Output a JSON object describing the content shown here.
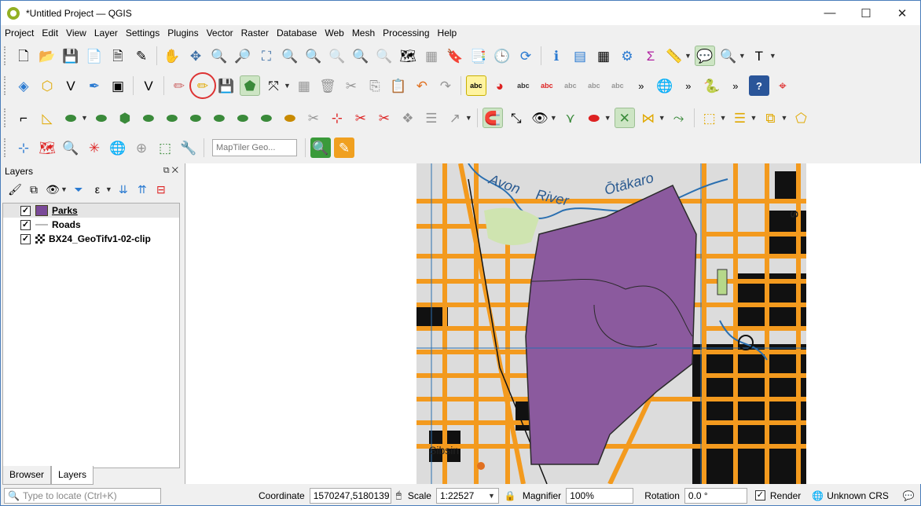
{
  "window": {
    "title": "*Untitled Project — QGIS",
    "minimize": "—",
    "maximize": "☐",
    "close": "✕"
  },
  "menu": [
    "Project",
    "Edit",
    "View",
    "Layer",
    "Settings",
    "Plugins",
    "Vector",
    "Raster",
    "Database",
    "Web",
    "Mesh",
    "Processing",
    "Help"
  ],
  "toolbar": {
    "locator_placeholder": "MapTiler Geo..."
  },
  "layers_panel": {
    "title": "Layers",
    "layers": [
      {
        "name": "Parks",
        "checked": "✓",
        "type": "polygon"
      },
      {
        "name": "Roads",
        "checked": "✓",
        "type": "line"
      },
      {
        "name": "BX24_GeoTifv1-02-clip",
        "checked": "✓",
        "type": "raster"
      }
    ],
    "tabs": [
      "Browser",
      "Layers"
    ]
  },
  "map_labels": [
    "Avon",
    "River",
    "Ōtākaro",
    "Sibsin",
    "S"
  ],
  "status": {
    "locate_placeholder": "Type to locate (Ctrl+K)",
    "coordinate_label": "Coordinate",
    "coordinate_value": "1570247,5180139",
    "scale_label": "Scale",
    "scale_value": "1:22527",
    "magnifier_label": "Magnifier",
    "magnifier_value": "100%",
    "rotation_label": "Rotation",
    "rotation_value": "0.0 °",
    "render_label": "Render",
    "crs_label": "Unknown CRS"
  },
  "colors": {
    "park_fill": "#8b5a9e",
    "road": "#f39a1e",
    "title_accent": "#4a7ebb",
    "highlight_circle": "#d33333"
  }
}
